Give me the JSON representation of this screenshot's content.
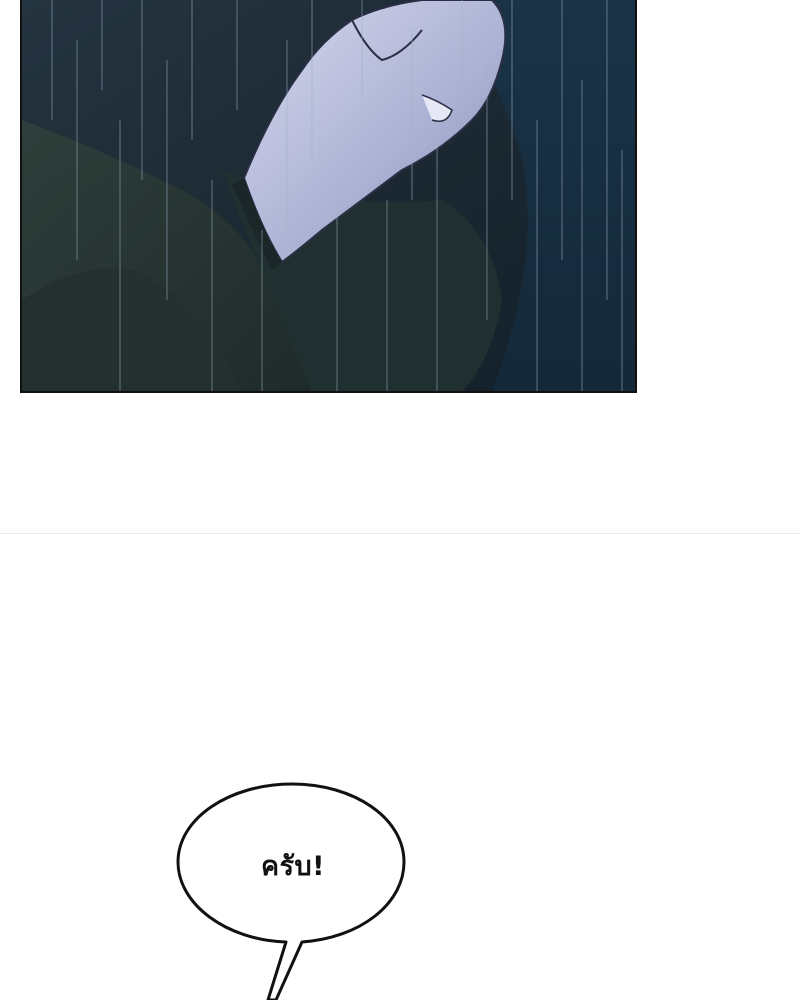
{
  "speech_bubble": {
    "text": "ครับ!"
  },
  "colors": {
    "panel_dark": "#1c2a35",
    "panel_deep": "#0f1a22",
    "skin_highlight": "#c9cee8",
    "skin_shadow": "#8b92b8",
    "rain": "#9fb0c4",
    "bubble_stroke": "#111111",
    "bubble_fill": "#ffffff"
  }
}
